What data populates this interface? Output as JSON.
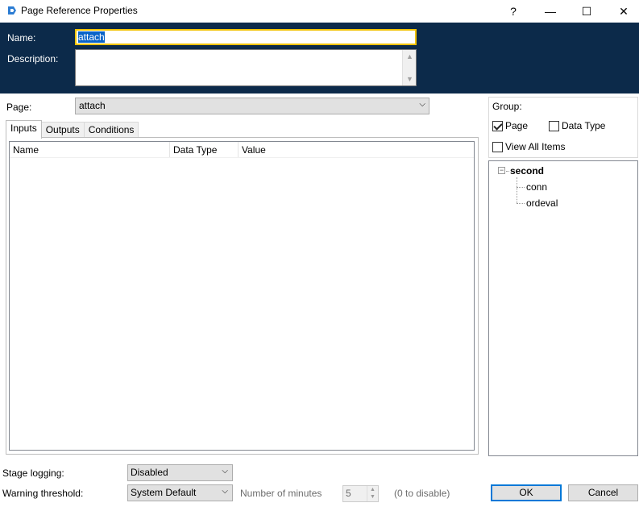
{
  "window": {
    "title": "Page Reference Properties",
    "help": "?",
    "minimize": "—",
    "maximize": "☐",
    "close": "✕",
    "icon": "page-reference-icon"
  },
  "header": {
    "name_label": "Name:",
    "name_value": "attach",
    "description_label": "Description:"
  },
  "page": {
    "label": "Page:",
    "value": "attach"
  },
  "tabs": [
    {
      "label": "Inputs",
      "active": true
    },
    {
      "label": "Outputs",
      "active": false
    },
    {
      "label": "Conditions",
      "active": false
    }
  ],
  "list": {
    "columns": [
      "Name",
      "Data Type",
      "Value"
    ]
  },
  "group": {
    "label": "Group:",
    "page_label": "Page",
    "page_checked": true,
    "datatype_label": "Data Type",
    "datatype_checked": false,
    "viewall_label": "View All Items",
    "viewall_checked": false
  },
  "tree": {
    "root": "second",
    "expander": "−",
    "children": [
      "conn",
      "ordeval"
    ]
  },
  "footer": {
    "stage_logging_label": "Stage logging:",
    "stage_logging_value": "Disabled",
    "warning_label": "Warning threshold:",
    "warning_value": "System Default",
    "minutes_label": "Number of minutes",
    "minutes_value": "5",
    "disable_hint": "(0 to disable)",
    "ok": "OK",
    "cancel": "Cancel"
  },
  "colors": {
    "header_band": "#0c2a4a",
    "focus_border": "#f2c200",
    "selection": "#0a64c8",
    "default_button_border": "#0078d7"
  }
}
